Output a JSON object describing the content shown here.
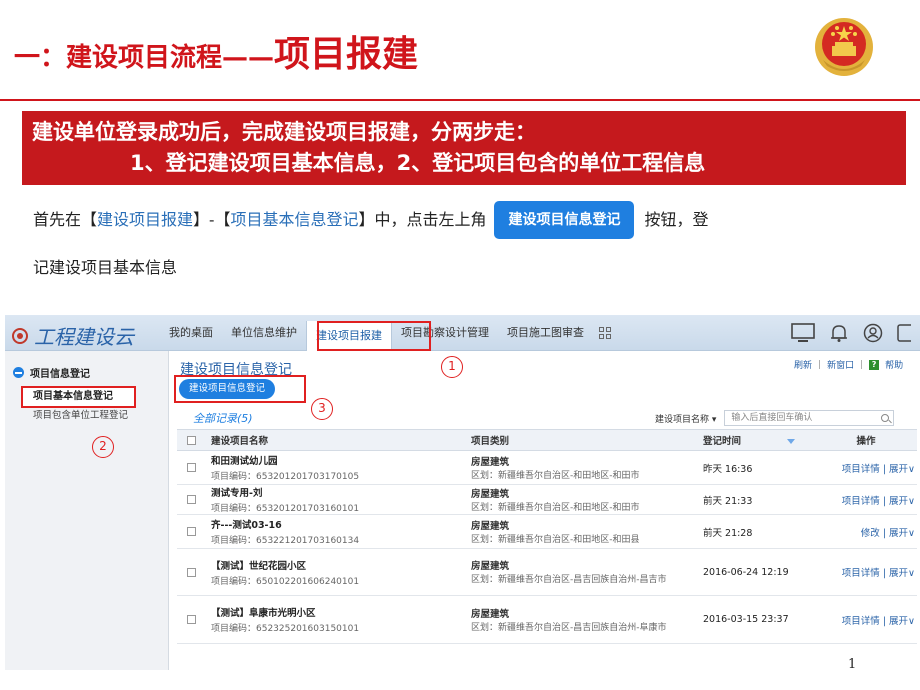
{
  "slide": {
    "title_part1": "一：建设项目流程——",
    "title_part2": "项目报建",
    "banner_line1": "建设单位登录成功后，完成建设项目报建，分两步走：",
    "banner_line2": "1、登记建设项目基本信息，2、登记项目包含的单位工程信息",
    "desc_prefix": "首先在【",
    "desc_link1": "建设项目报建",
    "desc_mid1": "】-【",
    "desc_link2": "项目基本信息登记",
    "desc_mid2": "】中，点击左上角",
    "desc_button": "建设项目信息登记",
    "desc_suffix": "按钮，登",
    "desc_line2": "记建设项目基本信息",
    "page_number": "1",
    "accent_color": "#d0151b"
  },
  "app": {
    "logo": "工程建设云",
    "nav": [
      "我的桌面",
      "单位信息维护",
      "建设项目报建",
      "项目勘察设计管理",
      "项目施工图审查"
    ],
    "nav_active": "建设项目报建",
    "sidebar": {
      "group": "项目信息登记",
      "item1": "项目基本信息登记",
      "item2": "项目包含单位工程登记"
    },
    "main": {
      "title": "建设项目信息登记",
      "link_refresh": "刷新",
      "link_new_window": "新窗口",
      "link_help": "帮助",
      "register_button": "建设项目信息登记",
      "tab_all": "全部记录(5)",
      "filter_select": "建设项目名称 ▾",
      "filter_placeholder": "输入后直接回车确认"
    },
    "annotations": [
      "1",
      "2",
      "3"
    ],
    "table": {
      "headers": [
        "建设项目名称",
        "项目类别",
        "登记时间",
        "操作"
      ],
      "rows": [
        {
          "name": "和田测试幼儿园",
          "code": "项目编码：653201201703170105",
          "type": "房屋建筑",
          "area": "区划：新疆维吾尔自治区-和田地区-和田市",
          "time": "昨天 16:36",
          "ops": "项目详情 | 展开∨"
        },
        {
          "name": "测试专用-刘",
          "code": "项目编码：653201201703160101",
          "type": "房屋建筑",
          "area": "区划：新疆维吾尔自治区-和田地区-和田市",
          "time": "前天 21:33",
          "ops": "项目详情 | 展开∨"
        },
        {
          "name": "齐---测试03-16",
          "code": "项目编码：653221201703160134",
          "type": "房屋建筑",
          "area": "区划：新疆维吾尔自治区-和田地区-和田县",
          "time": "前天 21:28",
          "ops": "修改 | 展开∨"
        },
        {
          "name": "【测试】世纪花园小区",
          "code": "项目编码：650102201606240101",
          "type": "房屋建筑",
          "area": "区划：新疆维吾尔自治区-昌吉回族自治州-昌吉市",
          "time": "2016-06-24 12:19",
          "ops": "项目详情 | 展开∨"
        },
        {
          "name": "【测试】阜康市光明小区",
          "code": "项目编码：652325201603150101",
          "type": "房屋建筑",
          "area": "区划：新疆维吾尔自治区-昌吉回族自治州-阜康市",
          "time": "2016-03-15 23:37",
          "ops": "项目详情 | 展开∨"
        }
      ]
    }
  }
}
